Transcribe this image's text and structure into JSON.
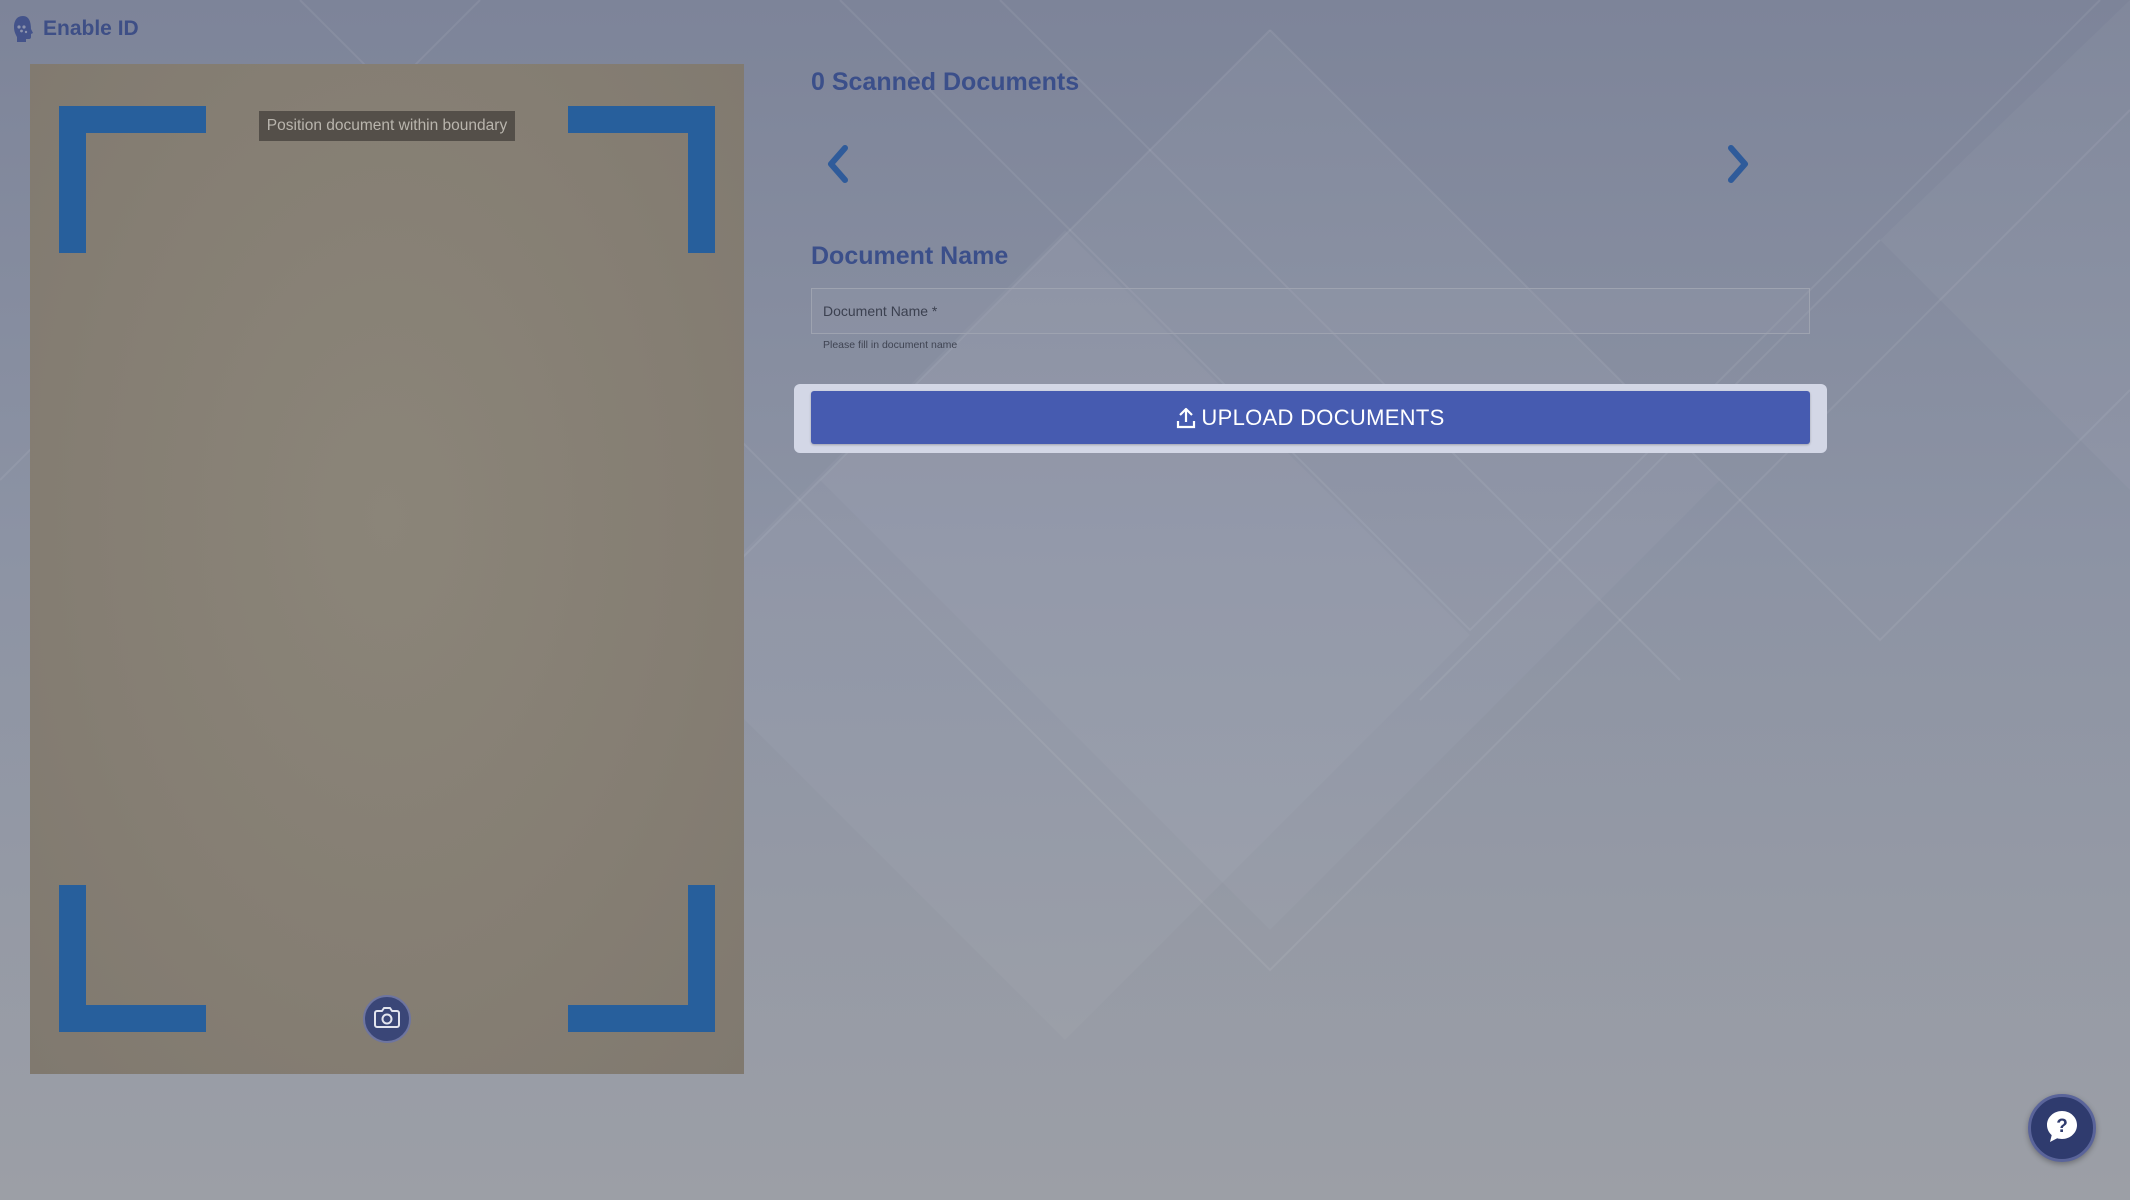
{
  "header": {
    "app_title": "Enable ID",
    "logo_icon": "face-silhouette-icon"
  },
  "camera": {
    "hint": "Position document within boundary",
    "capture_icon": "camera-icon",
    "frame_color": "#275f9c"
  },
  "documents": {
    "scanned_title": "0 Scanned Documents",
    "prev_icon": "chevron-left-icon",
    "next_icon": "chevron-right-icon"
  },
  "form": {
    "heading": "Document Name",
    "placeholder": "Document Name *",
    "value": "",
    "helper": "Please fill in document name"
  },
  "upload": {
    "label": "UPLOAD DOCUMENTS",
    "icon": "upload-icon",
    "color": "#465bb0"
  },
  "help": {
    "icon": "help-chat-icon",
    "symbol": "?"
  },
  "colors": {
    "accent": "#3b4f8a",
    "overlay": "#7d8499"
  }
}
